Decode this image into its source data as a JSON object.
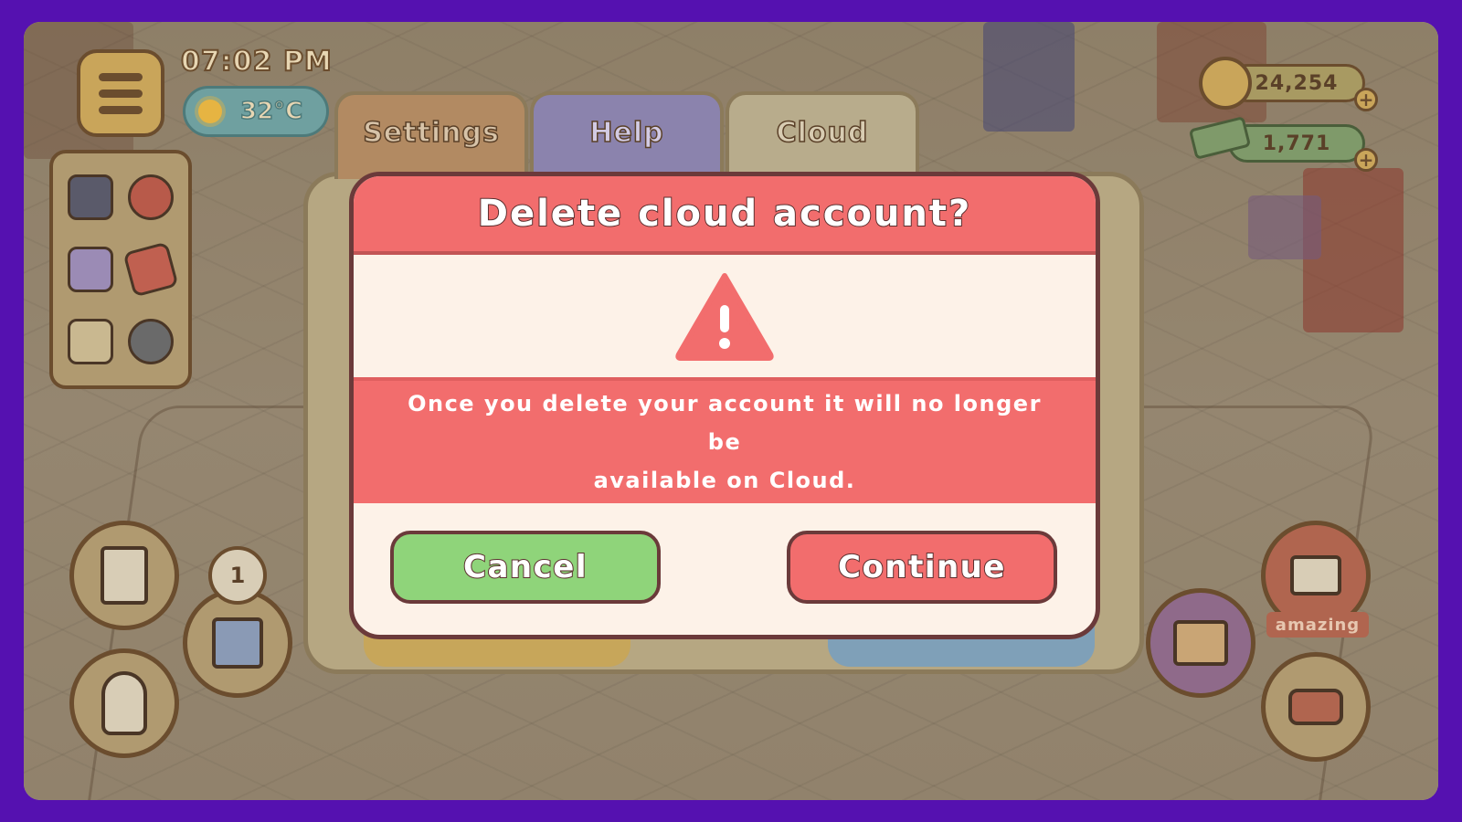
{
  "hud": {
    "time": "07:02 PM",
    "temperature": "32°C",
    "coins": "24,254",
    "cash": "1,771",
    "gift_badge_count": "1",
    "amazing_label": "amazing"
  },
  "tabs": [
    {
      "label": "Settings"
    },
    {
      "label": "Help"
    },
    {
      "label": "Cloud"
    }
  ],
  "dialog": {
    "title": "Delete cloud account?",
    "warning_icon": "warning-triangle-icon",
    "message_line1": "Once you delete your account it will no longer be",
    "message_line2": "available on Cloud.",
    "cancel_label": "Cancel",
    "continue_label": "Continue"
  },
  "colors": {
    "frame": "#5511b0",
    "dialog_red": "#f26d6d",
    "cancel_green": "#8fd47a",
    "dialog_cream": "#fdf2e8"
  }
}
